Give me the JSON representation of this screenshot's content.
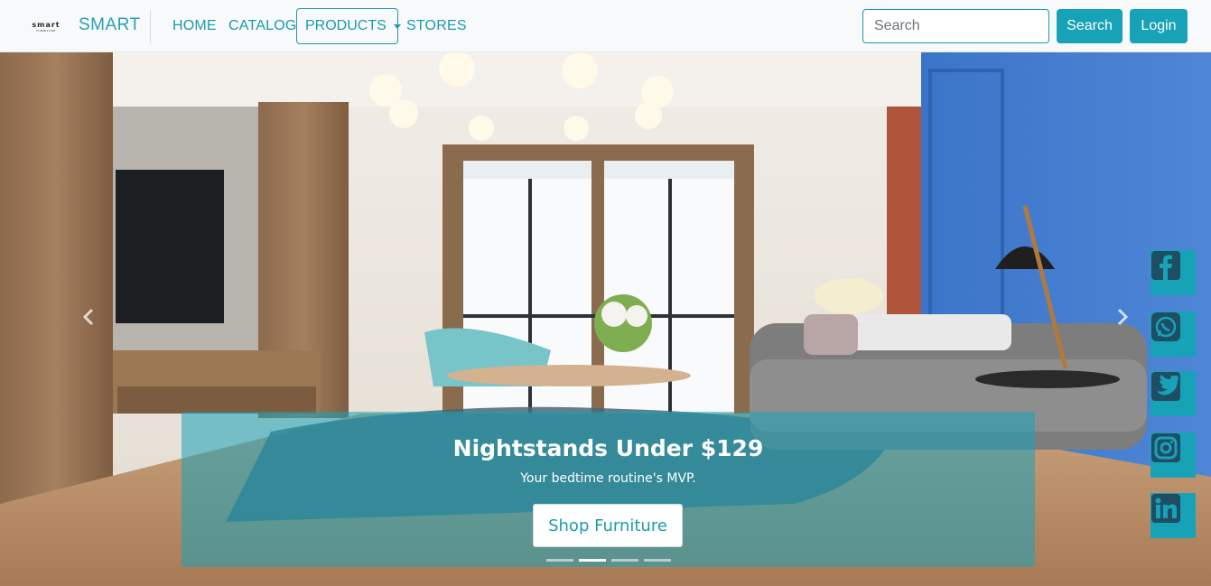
{
  "navbar": {
    "logo_line1": "smart",
    "logo_line2": "FURNITURE",
    "brand": "SMART",
    "links": {
      "home": "HOME",
      "catalog": "CATALOG",
      "products": "PRODUCTS",
      "stores": "STORES"
    },
    "search_placeholder": "Search",
    "search_button": "Search",
    "login_button": "Login"
  },
  "hero": {
    "title": "Nightstands Under $129",
    "subtitle": "Your bedtime routine's MVP.",
    "cta": "Shop Furniture",
    "slide_count": 4,
    "active_slide": 2
  },
  "social": [
    "facebook-icon",
    "whatsapp-icon",
    "twitter-icon",
    "instagram-icon",
    "linkedin-icon"
  ],
  "colors": {
    "accent": "#17a2b8",
    "navbar_bg": "#f7f9fa",
    "caption_bg": "rgba(23,162,184,0.55)"
  }
}
